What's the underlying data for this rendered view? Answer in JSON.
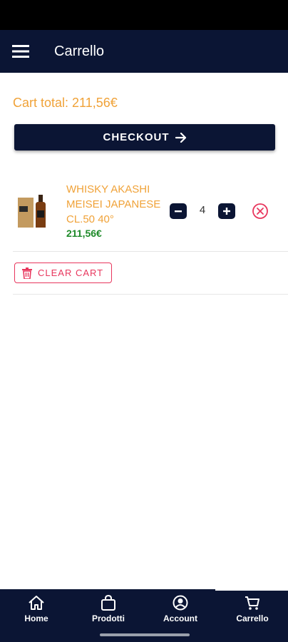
{
  "appbar": {
    "title": "Carrello"
  },
  "cart": {
    "total_label": "Cart total:",
    "total_value": "211,56€",
    "checkout_label": "CHECKOUT",
    "clear_label": "CLEAR CART",
    "items": [
      {
        "name": "WHISKY AKASHI MEISEI JAPANESE CL.50 40°",
        "price": "211,56€",
        "quantity": "4"
      }
    ]
  },
  "nav": {
    "items": [
      {
        "label": "Home",
        "icon": "home-icon"
      },
      {
        "label": "Prodotti",
        "icon": "bag-icon"
      },
      {
        "label": "Account",
        "icon": "account-icon"
      },
      {
        "label": "Carrello",
        "icon": "cart-icon"
      }
    ]
  },
  "colors": {
    "primary": "#0b1534",
    "accent": "#f0a238",
    "price": "#1f8a2a",
    "danger": "#e8365d"
  }
}
